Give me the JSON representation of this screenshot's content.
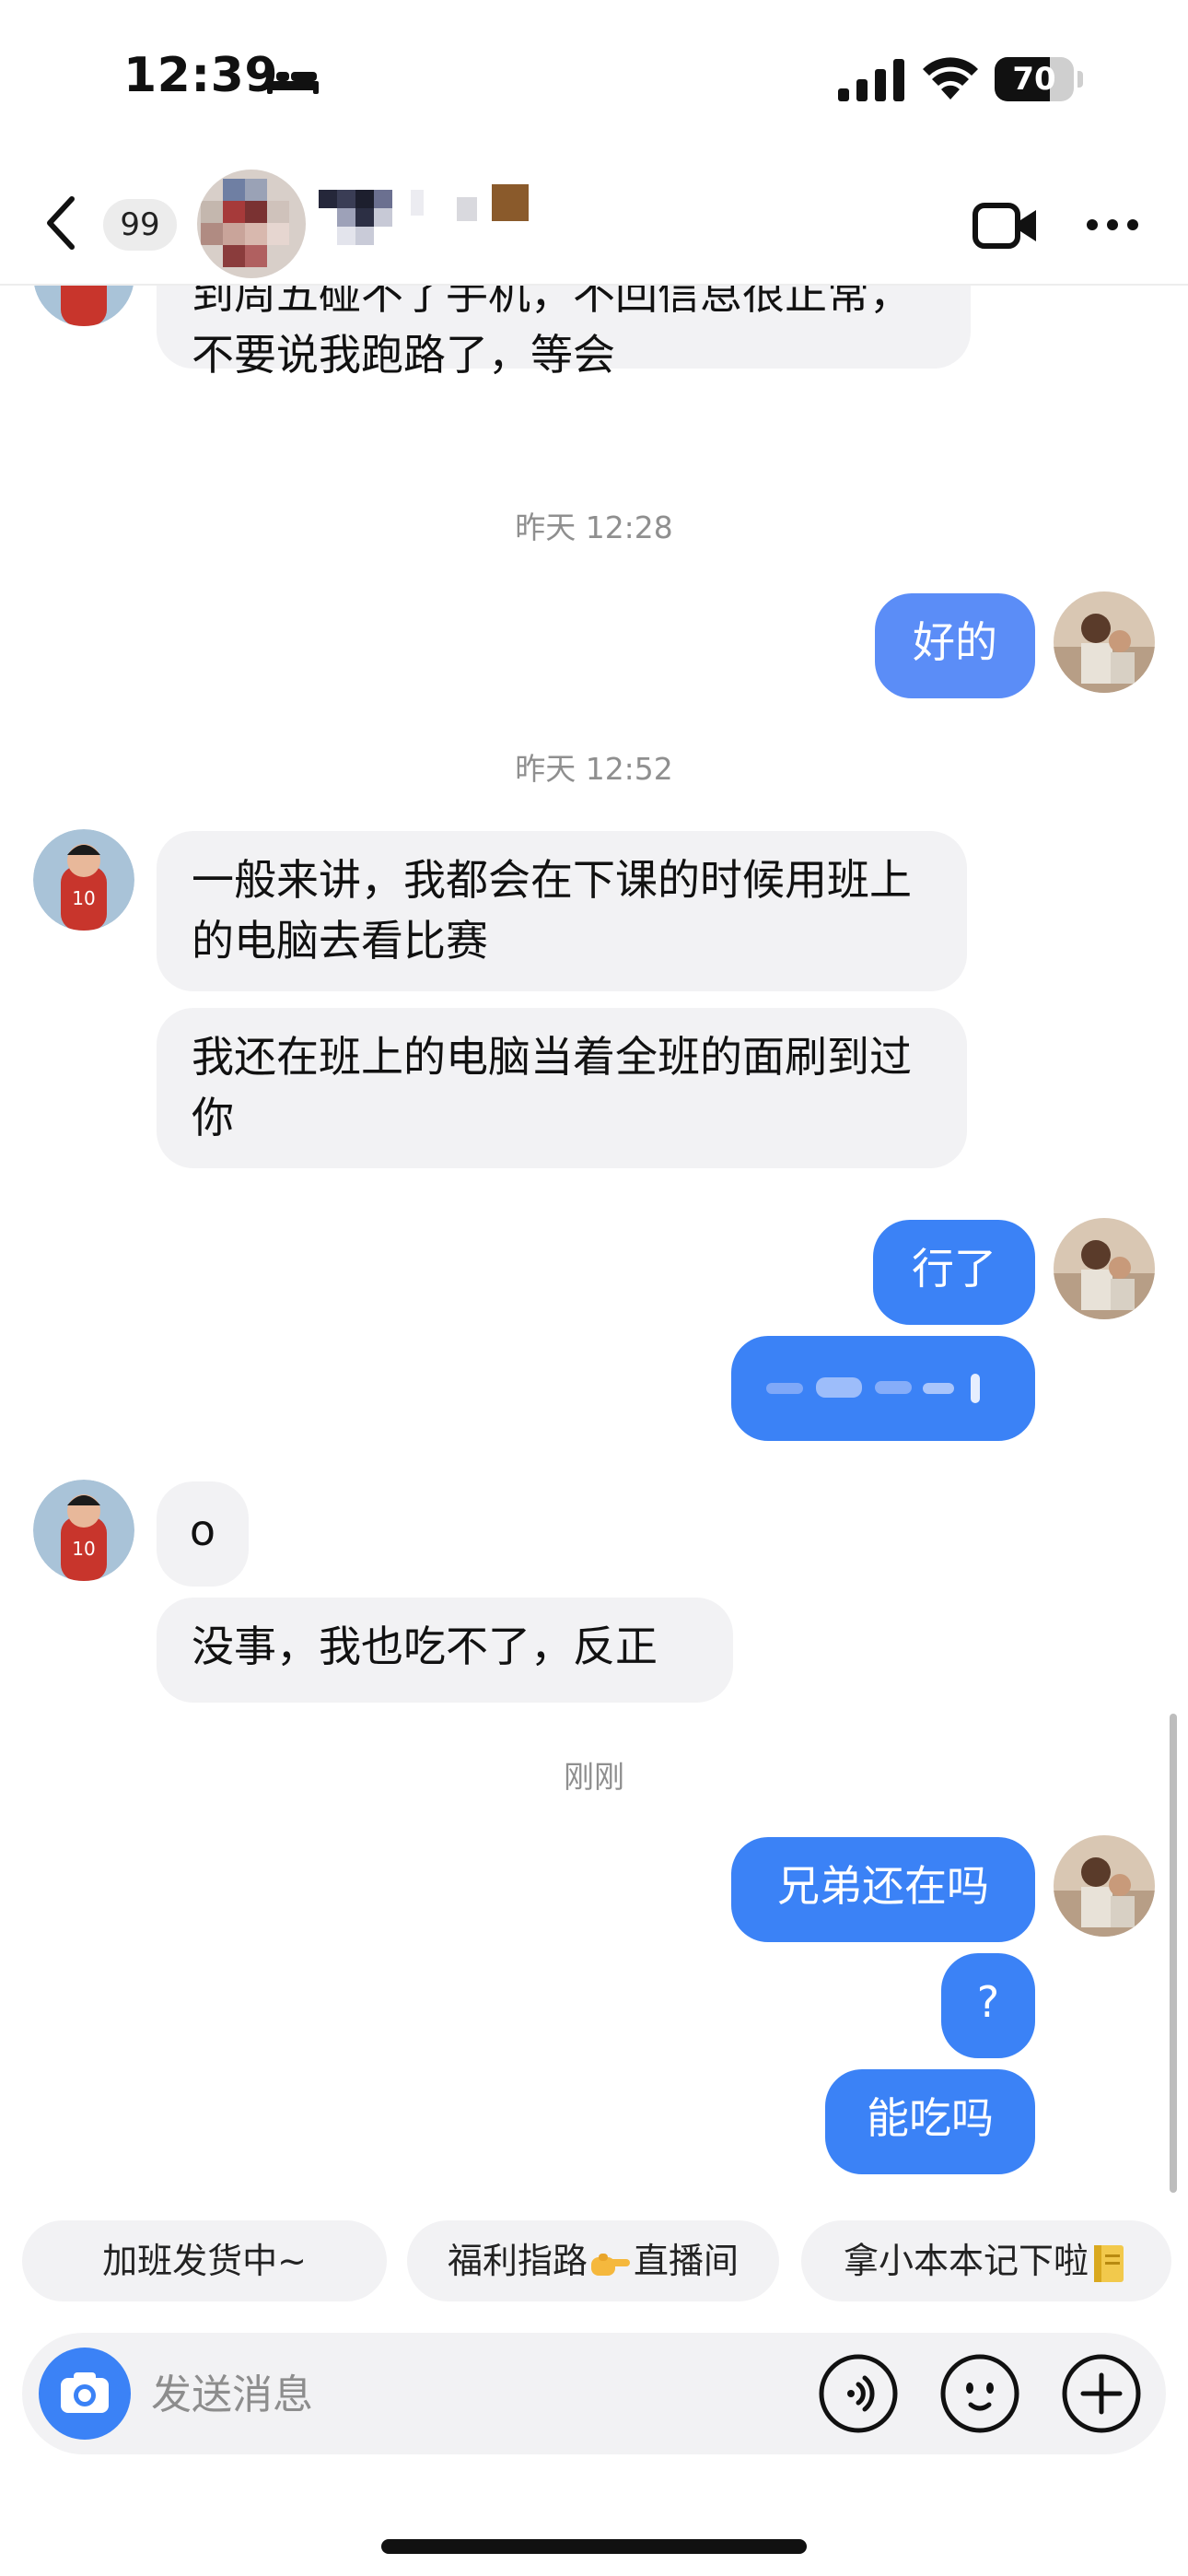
{
  "status_bar": {
    "time": "12:39",
    "battery_percent": 70,
    "battery_text": "70"
  },
  "header": {
    "unread_count": "99",
    "contact_name": ""
  },
  "colors": {
    "outgoing_bubble": "#3b82f6",
    "incoming_bubble": "#f2f2f4",
    "accent": "#3b82f6"
  },
  "messages": {
    "m1": "我先说一下，我因为学业原因，我周一到周五碰不了手机，不回信息很正常，不要说我跑路了，等会",
    "ts1": "昨天 12:28",
    "m2": "好的",
    "ts2": "昨天 12:52",
    "m3": "一般来讲，我都会在下课的时候用班上的电脑去看比赛",
    "m4": "我还在班上的电脑当着全班的面刷到过你",
    "m5": "行了",
    "m6": "",
    "m7": "o",
    "m8": "没事，我也吃不了，反正",
    "ts3": "刚刚",
    "m9": "兄弟还在吗",
    "m10": "?",
    "m11": "能吃吗"
  },
  "suggestions": {
    "s1": "加班发货中~",
    "s2_a": "福利指路",
    "s2_b": "直播间",
    "s3": "拿小本本记下啦"
  },
  "input": {
    "placeholder": "发送消息"
  },
  "icons": [
    "bed-icon",
    "signal-icon",
    "wifi-icon",
    "battery-icon",
    "back-icon",
    "video-call-icon",
    "more-icon",
    "camera-icon",
    "voice-icon",
    "emoji-icon",
    "plus-icon",
    "pointing-hand-emoji",
    "notebook-emoji"
  ]
}
